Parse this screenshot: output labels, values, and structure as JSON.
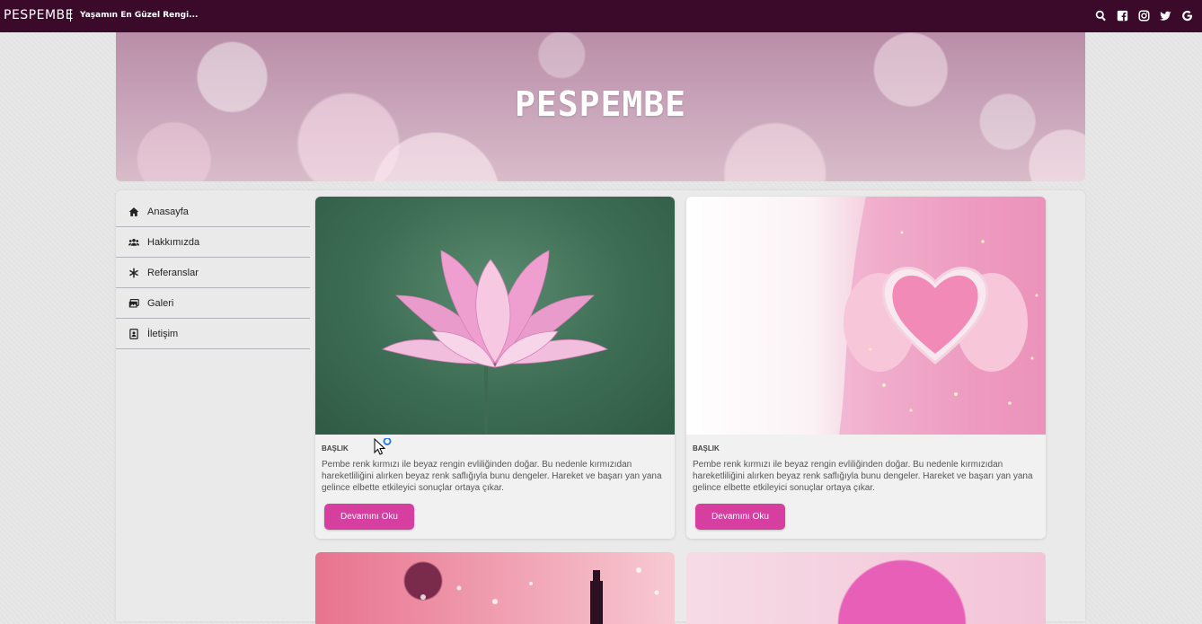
{
  "topbar": {
    "brand": "PESPEMBE",
    "tagline": "Yaşamın En Güzel Rengi...",
    "social_icons": [
      "search-icon",
      "facebook-icon",
      "instagram-icon",
      "twitter-icon",
      "google-icon"
    ]
  },
  "banner": {
    "title": "PESPEMBE"
  },
  "sidebar": {
    "items": [
      {
        "label": "Anasayfa",
        "icon": "home-icon"
      },
      {
        "label": "Hakkımızda",
        "icon": "users-icon"
      },
      {
        "label": "Referanslar",
        "icon": "asterisk-icon"
      },
      {
        "label": "Galeri",
        "icon": "images-icon"
      },
      {
        "label": "İletişim",
        "icon": "contact-icon"
      }
    ]
  },
  "cards": [
    {
      "title": "BAŞLIK",
      "text": "Pembe renk kırmızı ile beyaz rengin evliliğinden doğar. Bu nedenle kırmızıdan hareketliliğini alırken beyaz renk saflığıyla bunu dengeler. Hareket ve başarı yan yana gelince elbette etkileyici sonuçlar ortaya çıkar.",
      "button": "Devamını Oku"
    },
    {
      "title": "BAŞLIK",
      "text": "Pembe renk kırmızı ile beyaz rengin evliliğinden doğar. Bu nedenle kırmızıdan hareketliliğini alırken beyaz renk saflığıyla bunu dengeler. Hareket ve başarı yan yana gelince elbette etkileyici sonuçlar ortaya çıkar.",
      "button": "Devamını Oku"
    }
  ],
  "colors": {
    "topbar": "#3b0a2a",
    "accent": "#d63fa0"
  }
}
